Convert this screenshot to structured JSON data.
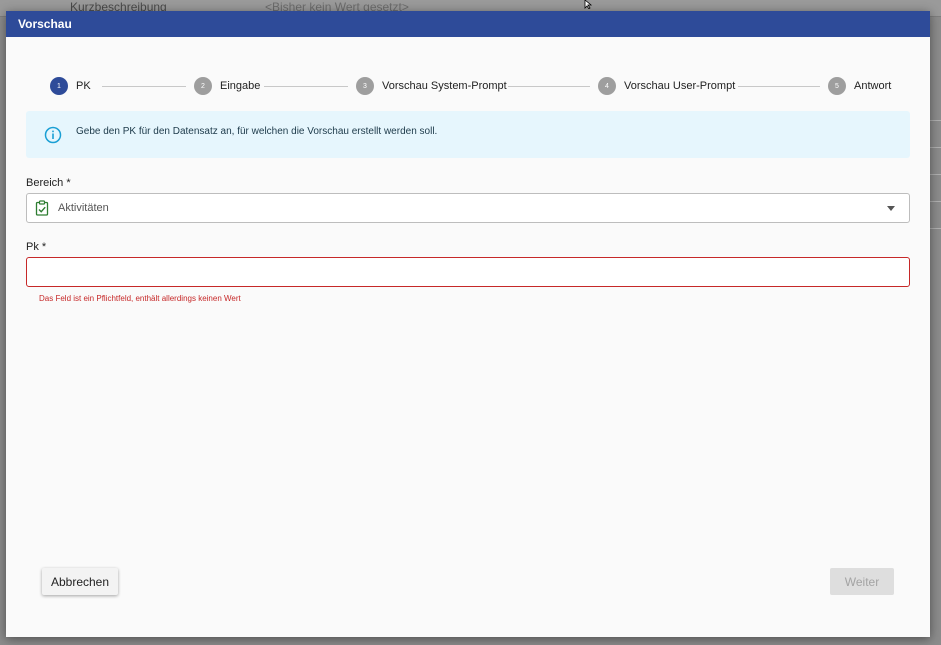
{
  "background": {
    "row_label": "Kurzbeschreibung",
    "row_value": "<Bisher kein Wert gesetzt>"
  },
  "modal": {
    "title": "Vorschau"
  },
  "stepper": {
    "steps": [
      {
        "num": "1",
        "label": "PK",
        "active": true
      },
      {
        "num": "2",
        "label": "Eingabe",
        "active": false
      },
      {
        "num": "3",
        "label": "Vorschau System-Prompt",
        "active": false
      },
      {
        "num": "4",
        "label": "Vorschau User-Prompt",
        "active": false
      },
      {
        "num": "5",
        "label": "Antwort",
        "active": false
      }
    ]
  },
  "info": {
    "icon": "info-circle-icon",
    "text": "Gebe den PK für den Datensatz an, für welchen die Vorschau erstellt werden soll."
  },
  "form": {
    "bereich_label": "Bereich *",
    "bereich_icon": "clipboard-check-icon",
    "bereich_value": "Aktivitäten",
    "pk_label": "Pk *",
    "pk_value": "",
    "pk_error": "Das Feld ist ein Pflichtfeld, enthält allerdings keinen Wert"
  },
  "buttons": {
    "cancel": "Abbrechen",
    "next": "Weiter"
  },
  "colors": {
    "primary": "#2e4b99",
    "error": "#c62828",
    "info_bg": "#e6f6fd",
    "info_icon": "#1a9fd4"
  }
}
